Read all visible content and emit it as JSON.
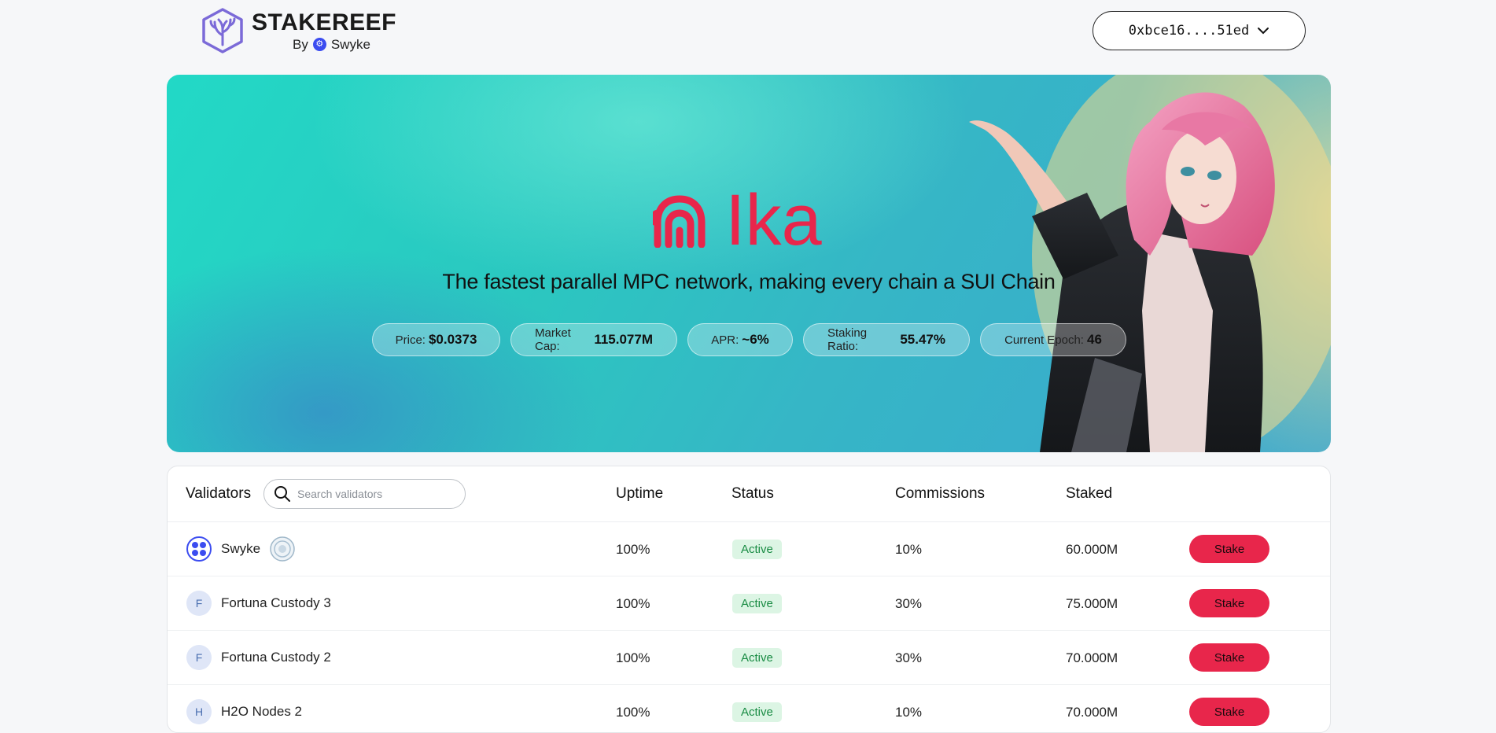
{
  "brand": {
    "name": "STAKEREEF",
    "by_label": "By",
    "partner": "Swyke"
  },
  "wallet": {
    "address": "0xbce16....51ed"
  },
  "hero": {
    "logo_text": "Ika",
    "tagline": "The fastest parallel MPC network, making every chain a SUI Chain",
    "stats": [
      {
        "label": "Price:",
        "value": "$0.0373"
      },
      {
        "label": "Market Cap:",
        "value": "115.077M"
      },
      {
        "label": "APR:",
        "value": "~6%"
      },
      {
        "label": "Staking Ratio:",
        "value": "55.47%"
      },
      {
        "label": "Current Epoch:",
        "value": "46"
      }
    ]
  },
  "table": {
    "headers": {
      "validators": "Validators",
      "uptime": "Uptime",
      "status": "Status",
      "commissions": "Commissions",
      "staked": "Staked"
    },
    "search_placeholder": "Search validators",
    "rows": [
      {
        "name": "Swyke",
        "avatar": "",
        "uptime": "100%",
        "status": "Active",
        "commission": "10%",
        "staked": "60.000M",
        "action": "Stake"
      },
      {
        "name": "Fortuna Custody 3",
        "avatar": "F",
        "uptime": "100%",
        "status": "Active",
        "commission": "30%",
        "staked": "75.000M",
        "action": "Stake"
      },
      {
        "name": "Fortuna Custody 2",
        "avatar": "F",
        "uptime": "100%",
        "status": "Active",
        "commission": "30%",
        "staked": "70.000M",
        "action": "Stake"
      },
      {
        "name": "H2O Nodes 2",
        "avatar": "H",
        "uptime": "100%",
        "status": "Active",
        "commission": "10%",
        "staked": "70.000M",
        "action": "Stake"
      }
    ]
  },
  "colors": {
    "accent": "#e8264b",
    "brand_purple": "#7b6ad8",
    "active_bg": "#dcf5e4",
    "active_text": "#1a8c44"
  }
}
